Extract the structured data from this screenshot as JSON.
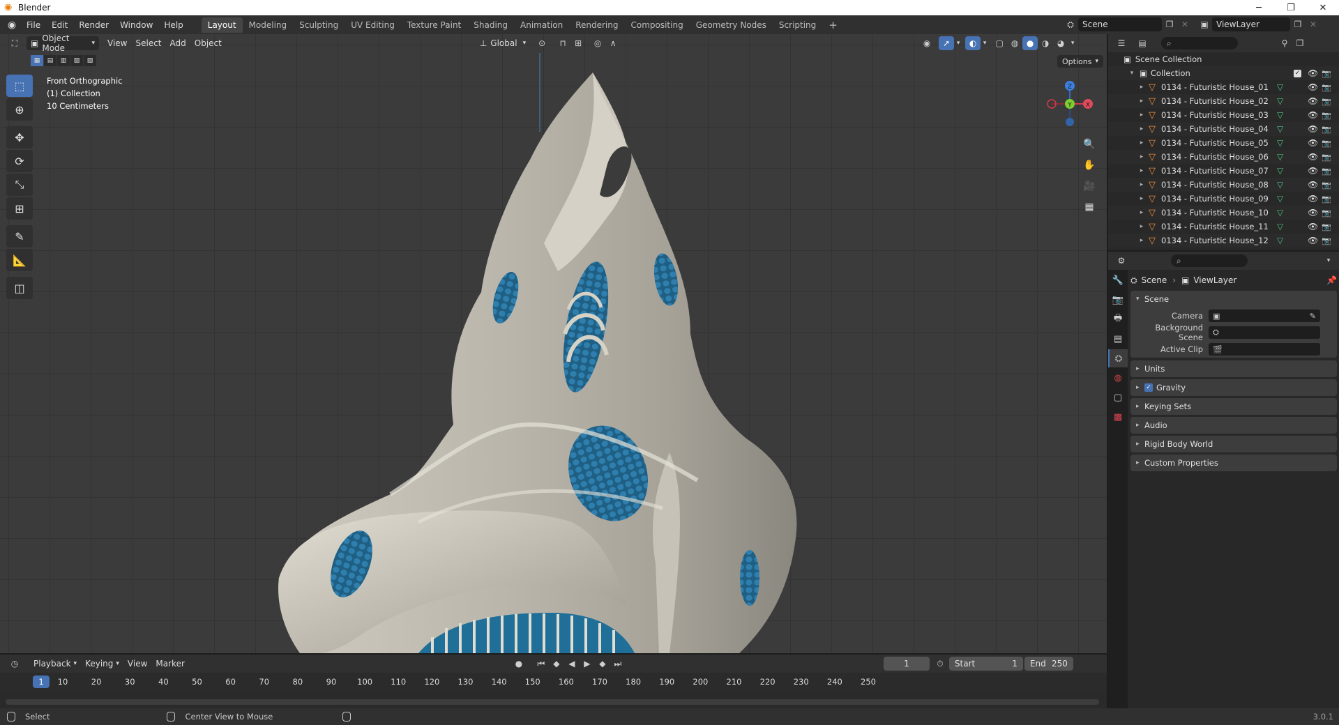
{
  "window": {
    "title": "Blender",
    "minimize": "─",
    "maximize": "❐",
    "close": "✕"
  },
  "menu": [
    "File",
    "Edit",
    "Render",
    "Window",
    "Help"
  ],
  "workspaces": [
    "Layout",
    "Modeling",
    "Sculpting",
    "UV Editing",
    "Texture Paint",
    "Shading",
    "Animation",
    "Rendering",
    "Compositing",
    "Geometry Nodes",
    "Scripting"
  ],
  "active_workspace": "Layout",
  "add_workspace": "+",
  "scene_selector": {
    "scene": "Scene",
    "view_layer": "ViewLayer"
  },
  "viewport": {
    "mode": "Object Mode",
    "menus": [
      "View",
      "Select",
      "Add",
      "Object"
    ],
    "transform_orientation": "Global",
    "options_label": "Options",
    "info": {
      "view": "Front Orthographic",
      "collection": "(1) Collection",
      "scale": "10 Centimeters"
    },
    "gizmo": {
      "z": "Z",
      "y": "Y",
      "x": "X"
    }
  },
  "timeline": {
    "menus": [
      "Playback",
      "Keying",
      "View",
      "Marker"
    ],
    "current_frame": "1",
    "start_label": "Start",
    "start": "1",
    "end_label": "End",
    "end": "250",
    "ruler_current": "1",
    "ruler": [
      "10",
      "20",
      "30",
      "40",
      "50",
      "60",
      "70",
      "80",
      "90",
      "100",
      "110",
      "120",
      "130",
      "140",
      "150",
      "160",
      "170",
      "180",
      "190",
      "200",
      "210",
      "220",
      "230",
      "240",
      "250"
    ]
  },
  "status": {
    "select": "Select",
    "center_view": "Center View to Mouse",
    "version": "3.0.1"
  },
  "outliner": {
    "root": "Scene Collection",
    "collection": "Collection",
    "items": [
      "0134 - Futuristic House_01",
      "0134 - Futuristic House_02",
      "0134 - Futuristic House_03",
      "0134 - Futuristic House_04",
      "0134 - Futuristic House_05",
      "0134 - Futuristic House_06",
      "0134 - Futuristic House_07",
      "0134 - Futuristic House_08",
      "0134 - Futuristic House_09",
      "0134 - Futuristic House_10",
      "0134 - Futuristic House_11",
      "0134 - Futuristic House_12"
    ]
  },
  "properties": {
    "breadcrumb": {
      "scene": "Scene",
      "separator": "›",
      "view_layer": "ViewLayer"
    },
    "scene_panel": "Scene",
    "camera_label": "Camera",
    "background_scene_label": "Background Scene",
    "active_clip_label": "Active Clip",
    "panels": [
      "Units",
      "Gravity",
      "Keying Sets",
      "Audio",
      "Rigid Body World",
      "Custom Properties"
    ]
  }
}
